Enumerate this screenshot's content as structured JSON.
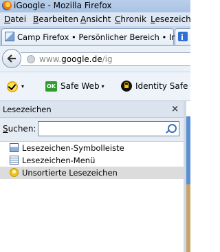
{
  "window": {
    "title": "iGoogle - Mozilla Firefox"
  },
  "menubar": {
    "items": [
      {
        "label": "Datei",
        "mnemonic": "D"
      },
      {
        "label": "Bearbeiten",
        "mnemonic": "B"
      },
      {
        "label": "Ansicht",
        "mnemonic": "A"
      },
      {
        "label": "Chronik",
        "mnemonic": "C"
      },
      {
        "label": "Lesezeichen",
        "mnemonic": "L"
      }
    ]
  },
  "tabs": [
    {
      "label": "Camp Firefox • Persönlicher Bereich • Inf...",
      "close": "×",
      "active": true
    },
    {
      "label": "i",
      "active": false
    }
  ],
  "navigation": {
    "url_prefix": "www.",
    "url_domain": "google.de",
    "url_path": "/ig"
  },
  "toolbar": {
    "check_caret": "▾",
    "ok_badge": "OK",
    "safe_web": "Safe Web",
    "identity_safe": "Identity Safe",
    "caret": "▾"
  },
  "sidebar": {
    "title": "Lesezeichen",
    "close": "×",
    "search_label": "Suchen:",
    "search_mnemonic": "S",
    "search_value": "",
    "items": [
      {
        "label": "Lesezeichen-Symbolleiste",
        "icon": "bookmarks-toolbar-icon",
        "selected": false
      },
      {
        "label": "Lesezeichen-Menü",
        "icon": "bookmarks-menu-icon",
        "selected": false
      },
      {
        "label": "Unsortierte Lesezeichen",
        "icon": "unsorted-bookmarks-icon",
        "selected": true
      }
    ]
  }
}
